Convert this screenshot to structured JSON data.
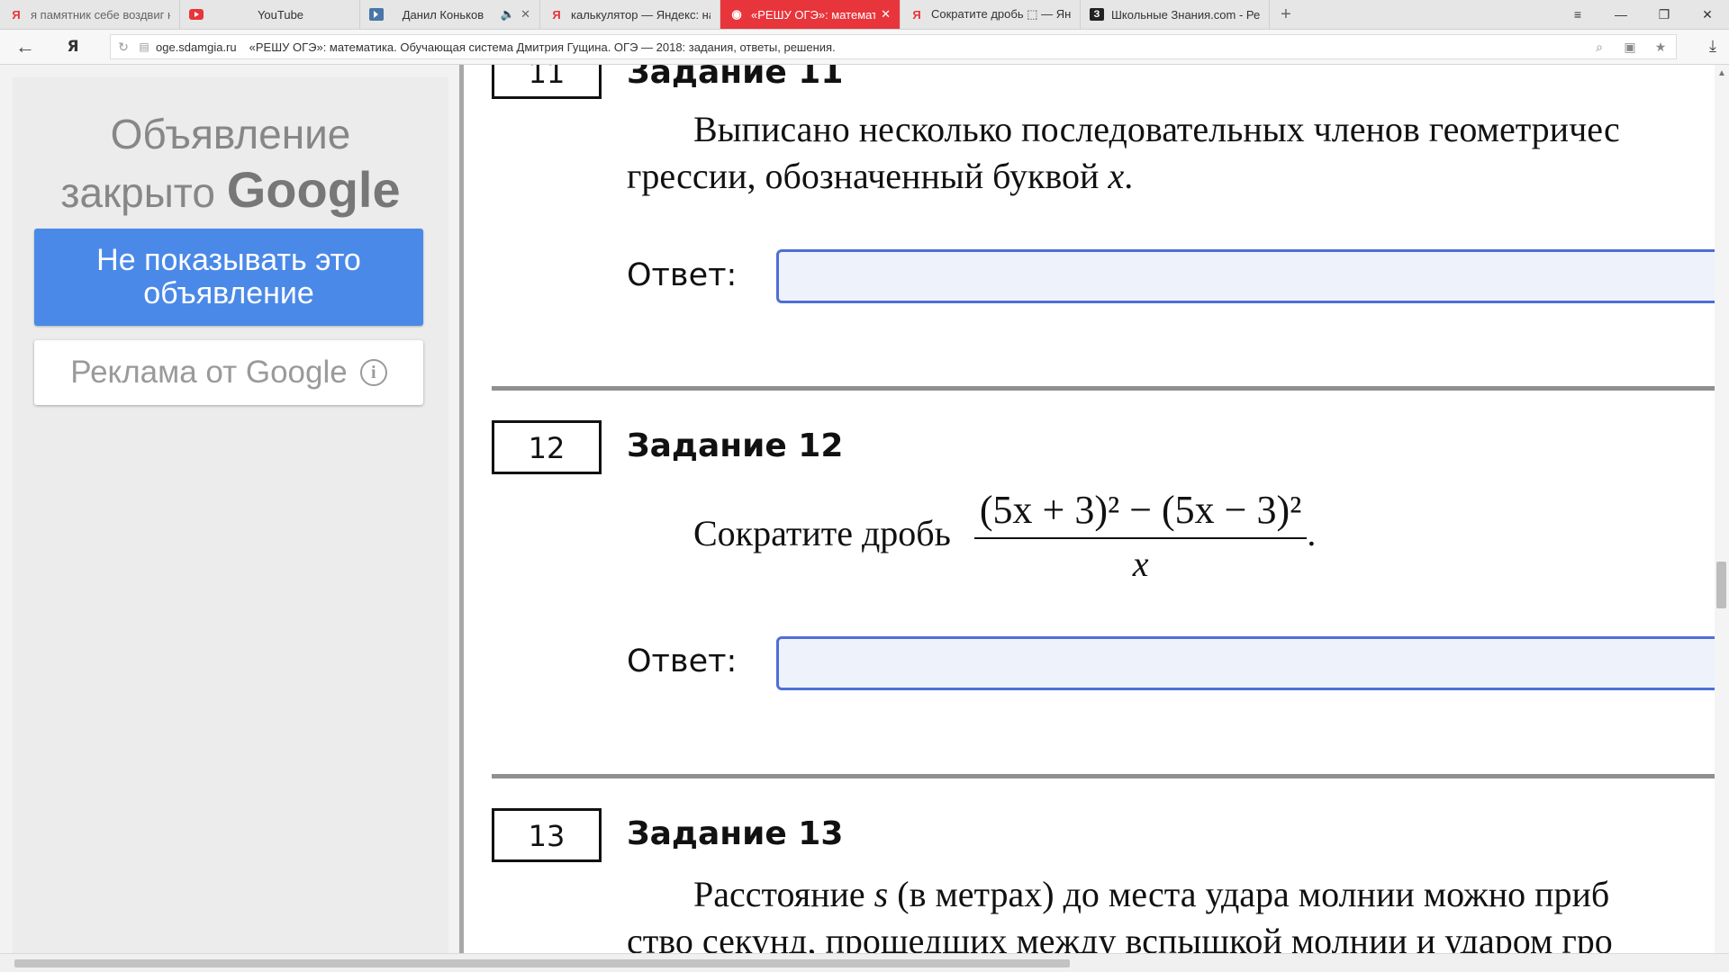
{
  "browser": {
    "tabs": [
      {
        "title": "я памятник себе воздвиг нерукотворный",
        "favicon": "yandex-icon"
      },
      {
        "title": "YouTube",
        "favicon": "youtube-icon"
      },
      {
        "title": "Данил Коньков",
        "favicon": "vk-player-icon"
      },
      {
        "title": "калькулятор — Яндекс: нашлось",
        "favicon": "yandex-icon"
      },
      {
        "title": "«РЕШУ ОГЭ»: математика",
        "favicon": "sdamgia-icon",
        "active": true
      },
      {
        "title": "Сократите дробь ⬚ — Яндекс",
        "favicon": "yandex-icon"
      },
      {
        "title": "Школьные Знания.com - Решаем",
        "favicon": "znanija-icon"
      }
    ],
    "new_tab": "+",
    "yandex_logo": "Я",
    "address": {
      "domain": "oge.sdamgia.ru",
      "page_title": "«РЕШУ ОГЭ»: математика. Обучающая система Дмитрия Гущина. ОГЭ — 2018: задания, ответы, решения."
    }
  },
  "ad": {
    "closed_line1": "Объявление",
    "closed_line2": "закрыто",
    "google_word": "Google",
    "hide_button": "Не показывать это объявление",
    "ads_by": "Реклама от Google",
    "info_glyph": "i"
  },
  "tasks": [
    {
      "number": "11",
      "title": "Задание 11",
      "text_line1": "Выписано несколько последовательных членов геометричес",
      "text_line2_start": "грессии, обозначенный буквой ",
      "text_line2_var": "x",
      "text_line2_end": ".",
      "answer_label": "Ответ:"
    },
    {
      "number": "12",
      "title": "Задание 12",
      "text": "Сократите дробь",
      "fraction_numerator": "(5x + 3)² − (5x − 3)²",
      "fraction_denominator": "x",
      "text_end": ".",
      "answer_label": "Ответ:"
    },
    {
      "number": "13",
      "title": "Задание 13",
      "text_line1_start": "Расстояние ",
      "text_line1_var": "s",
      "text_line1_end": " (в метрах) до места удара молнии можно приб",
      "text_line2": "ство секунд, прошедших между вспышкой молнии и ударом гро"
    }
  ]
}
